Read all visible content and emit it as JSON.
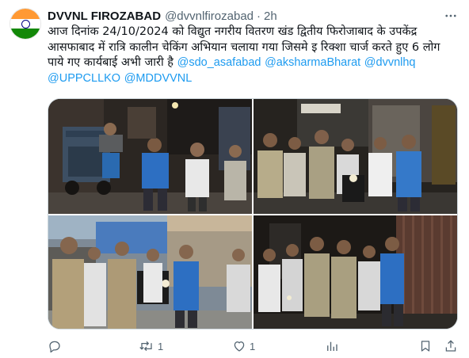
{
  "author": {
    "name": "DVVNL FIROZABAD",
    "handle": "@dvvnlfirozabad",
    "separator": "·",
    "time": "2h"
  },
  "tweet": {
    "text": "आज दिनांक 24/10/2024 को विद्युत नगरीय वितरण खंड द्वितीय फिरोजाबाद के उपकेंद्र आसफाबाद में रात्रि कालीन चेकिंग अभियान चलाया गया जिसमे इ रिक्शा चार्ज करते हुए 6 लोग पाये गए कार्यबाई अभी जारी है",
    "mentions": [
      "@sdo_asafabad",
      "@aksharmaBharat",
      "@dvvnlhq",
      "@UPPCLLKO",
      "@MDDVVNL"
    ]
  },
  "media": {
    "photos": [
      {
        "label": "photo-1"
      },
      {
        "label": "photo-2"
      },
      {
        "label": "photo-3"
      },
      {
        "label": "photo-4"
      }
    ]
  },
  "actions": {
    "reply_count": "",
    "retweet_count": "1",
    "like_count": "1",
    "views_count": ""
  },
  "icons": {
    "avatar": "india-flag-avatar",
    "more": "more-dots-icon",
    "reply": "reply-icon",
    "retweet": "retweet-icon",
    "like": "heart-icon",
    "views": "views-icon",
    "bookmark": "bookmark-icon",
    "share": "share-icon"
  },
  "colors": {
    "link": "#1d9bf0",
    "secondary_text": "#536471",
    "primary_text": "#0f1419",
    "border": "#cfd9de"
  }
}
